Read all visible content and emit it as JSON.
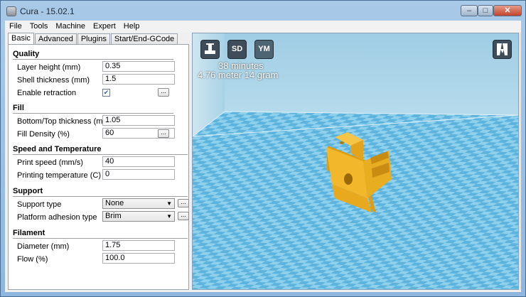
{
  "window": {
    "title": "Cura - 15.02.1",
    "min": "–",
    "max": "□",
    "close": "✕"
  },
  "menu": [
    "File",
    "Tools",
    "Machine",
    "Expert",
    "Help"
  ],
  "tabs": [
    "Basic",
    "Advanced",
    "Plugins",
    "Start/End-GCode"
  ],
  "sections": {
    "quality": "Quality",
    "fill": "Fill",
    "speed": "Speed and Temperature",
    "support": "Support",
    "filament": "Filament"
  },
  "fields": {
    "layer_height": {
      "label": "Layer height (mm)",
      "value": "0.35"
    },
    "shell_thickness": {
      "label": "Shell thickness (mm)",
      "value": "1.5"
    },
    "enable_retraction": {
      "label": "Enable retraction",
      "checked": true,
      "check_glyph": "✔"
    },
    "bottom_top_thickness": {
      "label": "Bottom/Top thickness (mm)",
      "value": "1.05"
    },
    "fill_density": {
      "label": "Fill Density (%)",
      "value": "60"
    },
    "print_speed": {
      "label": "Print speed (mm/s)",
      "value": "40"
    },
    "printing_temperature": {
      "label": "Printing temperature (C)",
      "value": "0"
    },
    "support_type": {
      "label": "Support type",
      "value": "None"
    },
    "platform_adhesion": {
      "label": "Platform adhesion type",
      "value": "Brim"
    },
    "diameter": {
      "label": "Diameter (mm)",
      "value": "1.75"
    },
    "flow": {
      "label": "Flow (%)",
      "value": "100.0"
    }
  },
  "more_button": "...",
  "viewport": {
    "load_icon": "load-model-icon",
    "sd_label": "SD",
    "ym_label": "YM",
    "print_time": "38 minutes",
    "material": "4.76 meter 14 gram",
    "view_mode_icon": "view-mode-icon",
    "colors": {
      "bed_light": "#8fd0ec",
      "bed_dark": "#5cb3dd",
      "wall": "#a9d2e6",
      "model": "#f2b72a"
    }
  }
}
